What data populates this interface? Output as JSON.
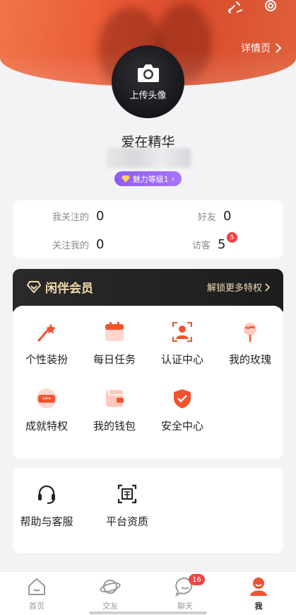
{
  "header": {
    "detail_link": "详情页",
    "edit_icon": "edit-pen-icon",
    "settings_icon": "gear-icon"
  },
  "profile": {
    "avatar_upload_label": "上传头像",
    "username": "爱在精华",
    "charm_level": "魅力等级1"
  },
  "stats": {
    "following_label": "我关注的",
    "following_value": "0",
    "friends_label": "好友",
    "friends_value": "0",
    "followers_label": "关注我的",
    "followers_value": "0",
    "visitors_label": "访客",
    "visitors_value": "5",
    "visitors_badge": "5"
  },
  "vip": {
    "title": "闲伴会员",
    "unlock": "解锁更多特权",
    "items": [
      {
        "label": "个性装扮",
        "icon": "magic-wand-icon"
      },
      {
        "label": "每日任务",
        "icon": "calendar-icon"
      },
      {
        "label": "认证中心",
        "icon": "id-verify-icon"
      },
      {
        "label": "我的玫瑰",
        "icon": "rose-icon"
      },
      {
        "label": "成就特权",
        "icon": "badge-card-icon"
      },
      {
        "label": "我的钱包",
        "icon": "wallet-icon"
      },
      {
        "label": "安全中心",
        "icon": "shield-check-icon"
      }
    ]
  },
  "help": {
    "items": [
      {
        "label": "帮助与客服",
        "icon": "headset-icon"
      },
      {
        "label": "平台资质",
        "icon": "certificate-icon"
      }
    ]
  },
  "tabbar": {
    "items": [
      {
        "label": "首页",
        "icon": "home-icon"
      },
      {
        "label": "交友",
        "icon": "planet-icon"
      },
      {
        "label": "聊天",
        "icon": "chat-bubble-icon"
      },
      {
        "label": "我",
        "icon": "profile-icon"
      }
    ],
    "chat_badge": "16",
    "active_index": 3
  },
  "colors": {
    "accent": "#f0532e",
    "vip_gold": "#f5dcae",
    "badge_red": "#ef4444",
    "charm_purple": "#9866f3"
  }
}
